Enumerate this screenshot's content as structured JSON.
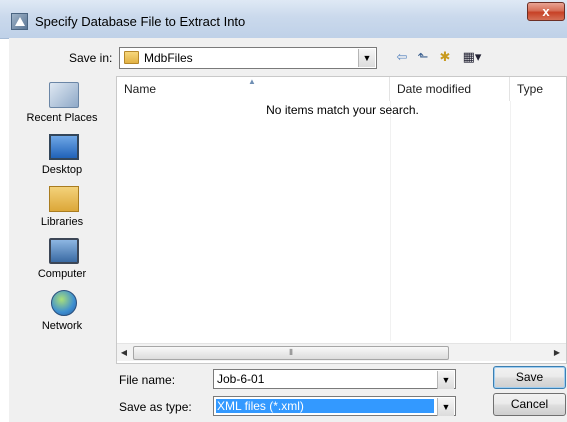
{
  "window": {
    "title": "Specify Database File to Extract Into",
    "close_label": "x"
  },
  "toolbar": {
    "save_in_label": "Save in:",
    "save_in_value": "MdbFiles",
    "back_icon": "back-arrow-icon",
    "up_icon": "up-folder-icon",
    "new_folder_icon": "new-folder-icon",
    "views_icon": "views-menu-icon"
  },
  "places": [
    {
      "label": "Recent Places",
      "icon": "recent-places-icon"
    },
    {
      "label": "Desktop",
      "icon": "desktop-icon"
    },
    {
      "label": "Libraries",
      "icon": "libraries-icon"
    },
    {
      "label": "Computer",
      "icon": "computer-icon"
    },
    {
      "label": "Network",
      "icon": "network-icon"
    }
  ],
  "filelist": {
    "columns": [
      "Name",
      "Date modified",
      "Type"
    ],
    "empty_message": "No items match your search."
  },
  "form": {
    "file_name_label": "File name:",
    "file_name_value": "Job-6-01",
    "save_as_type_label": "Save as type:",
    "save_as_type_value": "XML files (*.xml)"
  },
  "buttons": {
    "save": "Save",
    "cancel": "Cancel"
  }
}
